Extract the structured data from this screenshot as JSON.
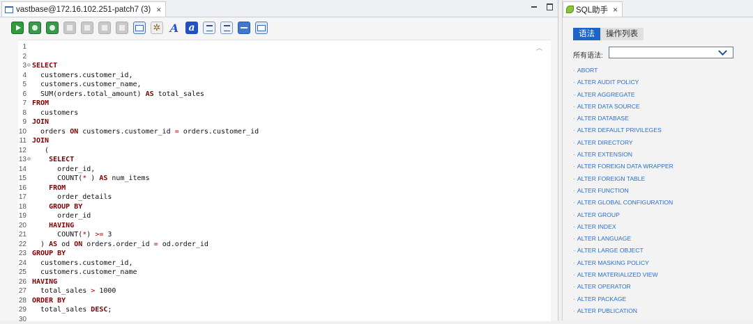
{
  "editor": {
    "tab_label": "vastbase@172.16.102.251-patch7 (3)",
    "tab_close": "×"
  },
  "helper": {
    "tab_label": "SQL助手",
    "tab_close": "×",
    "seg_syntax": "语法",
    "seg_ops": "操作列表",
    "syntax_label": "所有语法:",
    "syntax_value": ""
  },
  "code_lines": [
    {
      "n": "1",
      "fold": false,
      "t": []
    },
    {
      "n": "2",
      "fold": false,
      "t": []
    },
    {
      "n": "3",
      "fold": true,
      "t": [
        [
          "kw",
          "SELECT"
        ]
      ]
    },
    {
      "n": "4",
      "fold": false,
      "t": [
        [
          "",
          "  customers.customer_id,"
        ]
      ]
    },
    {
      "n": "5",
      "fold": false,
      "t": [
        [
          "",
          "  customers.customer_name,"
        ]
      ]
    },
    {
      "n": "6",
      "fold": false,
      "t": [
        [
          "",
          "  SUM(orders.total_amount) "
        ],
        [
          "kw",
          "AS"
        ],
        [
          "",
          " total_sales"
        ]
      ]
    },
    {
      "n": "7",
      "fold": false,
      "t": [
        [
          "kw",
          "FROM"
        ]
      ]
    },
    {
      "n": "8",
      "fold": false,
      "t": [
        [
          "",
          "  customers"
        ]
      ]
    },
    {
      "n": "9",
      "fold": false,
      "t": [
        [
          "kw",
          "JOIN"
        ]
      ]
    },
    {
      "n": "10",
      "fold": false,
      "t": [
        [
          "",
          "  orders "
        ],
        [
          "kw",
          "ON"
        ],
        [
          "",
          " customers.customer_id "
        ],
        [
          "op",
          "="
        ],
        [
          "",
          " orders.customer_id"
        ]
      ]
    },
    {
      "n": "11",
      "fold": false,
      "t": [
        [
          "kw",
          "JOIN"
        ]
      ]
    },
    {
      "n": "12",
      "fold": false,
      "t": [
        [
          "",
          "   ("
        ]
      ]
    },
    {
      "n": "13",
      "fold": true,
      "t": [
        [
          "",
          "    "
        ],
        [
          "kw",
          "SELECT"
        ]
      ]
    },
    {
      "n": "14",
      "fold": false,
      "t": [
        [
          "",
          "      order_id,"
        ]
      ]
    },
    {
      "n": "15",
      "fold": false,
      "t": [
        [
          "",
          "      COUNT("
        ],
        [
          "op",
          "*"
        ],
        [
          "",
          " ) "
        ],
        [
          "kw",
          "AS"
        ],
        [
          "",
          " num_items"
        ]
      ]
    },
    {
      "n": "16",
      "fold": false,
      "t": [
        [
          "",
          "    "
        ],
        [
          "kw",
          "FROM"
        ]
      ]
    },
    {
      "n": "17",
      "fold": false,
      "t": [
        [
          "",
          "      order_details"
        ]
      ]
    },
    {
      "n": "18",
      "fold": false,
      "t": [
        [
          "",
          "    "
        ],
        [
          "kw",
          "GROUP BY"
        ]
      ]
    },
    {
      "n": "19",
      "fold": false,
      "t": [
        [
          "",
          "      order_id"
        ]
      ]
    },
    {
      "n": "20",
      "fold": false,
      "t": [
        [
          "",
          "    "
        ],
        [
          "kw",
          "HAVING"
        ]
      ]
    },
    {
      "n": "21",
      "fold": false,
      "t": [
        [
          "",
          "      COUNT("
        ],
        [
          "op",
          "*"
        ],
        [
          "",
          ") "
        ],
        [
          "op",
          ">="
        ],
        [
          "",
          " 3"
        ]
      ]
    },
    {
      "n": "22",
      "fold": false,
      "t": [
        [
          "",
          "  ) "
        ],
        [
          "kw",
          "AS"
        ],
        [
          "",
          " od "
        ],
        [
          "kw",
          "ON"
        ],
        [
          "",
          " orders.order_id "
        ],
        [
          "op",
          "="
        ],
        [
          "",
          " od.order_id"
        ]
      ]
    },
    {
      "n": "23",
      "fold": false,
      "t": [
        [
          "kw",
          "GROUP BY"
        ]
      ]
    },
    {
      "n": "24",
      "fold": false,
      "t": [
        [
          "",
          "  customers.customer_id,"
        ]
      ]
    },
    {
      "n": "25",
      "fold": false,
      "t": [
        [
          "",
          "  customers.customer_name"
        ]
      ]
    },
    {
      "n": "26",
      "fold": false,
      "t": [
        [
          "kw",
          "HAVING"
        ]
      ]
    },
    {
      "n": "27",
      "fold": false,
      "t": [
        [
          "",
          "  total_sales "
        ],
        [
          "op",
          ">"
        ],
        [
          "",
          " 1000"
        ]
      ]
    },
    {
      "n": "28",
      "fold": false,
      "t": [
        [
          "kw",
          "ORDER BY"
        ]
      ]
    },
    {
      "n": "29",
      "fold": false,
      "t": [
        [
          "",
          "  total_sales "
        ],
        [
          "kw",
          "DESC"
        ],
        [
          "",
          ";"
        ]
      ]
    },
    {
      "n": "30",
      "fold": false,
      "t": []
    }
  ],
  "syntax_items": [
    "ABORT",
    "ALTER AUDIT POLICY",
    "ALTER AGGREGATE",
    "ALTER DATA SOURCE",
    "ALTER DATABASE",
    "ALTER DEFAULT PRIVILEGES",
    "ALTER DIRECTORY",
    "ALTER EXTENSION",
    "ALTER FOREIGN DATA WRAPPER",
    "ALTER FOREIGN TABLE",
    "ALTER FUNCTION",
    "ALTER GLOBAL CONFIGURATION",
    "ALTER GROUP",
    "ALTER INDEX",
    "ALTER LANGUAGE",
    "ALTER LARGE OBJECT",
    "ALTER MASKING POLICY",
    "ALTER MATERIALIZED VIEW",
    "ALTER OPERATOR",
    "ALTER PACKAGE",
    "ALTER PUBLICATION"
  ],
  "toolbar": [
    {
      "name": "execute-icon",
      "cls": "tb-run"
    },
    {
      "name": "execute-step-icon",
      "cls": "tb-green"
    },
    {
      "name": "execute-plan-icon",
      "cls": "tb-green"
    },
    {
      "name": "commit-icon",
      "cls": "tb-gray"
    },
    {
      "name": "rollback-icon",
      "cls": "tb-gray"
    },
    {
      "name": "stop-icon",
      "cls": "tb-gray"
    },
    {
      "name": "disconnect-icon",
      "cls": "tb-gray"
    },
    {
      "name": "export-icon",
      "cls": "tb-blue"
    },
    {
      "name": "settings-icon",
      "cls": "tb-gear",
      "glyph": "✲"
    },
    {
      "name": "uppercase-icon",
      "cls": "tb-letter",
      "glyph": "A"
    },
    {
      "name": "lowercase-icon",
      "cls": "tb-letter boxed",
      "glyph": "a"
    },
    {
      "name": "comment-icon",
      "cls": "tb-lines"
    },
    {
      "name": "uncomment-icon",
      "cls": "tb-lines"
    },
    {
      "name": "indent-icon",
      "cls": "tb-bar"
    },
    {
      "name": "format-icon",
      "cls": "tb-blue"
    }
  ]
}
